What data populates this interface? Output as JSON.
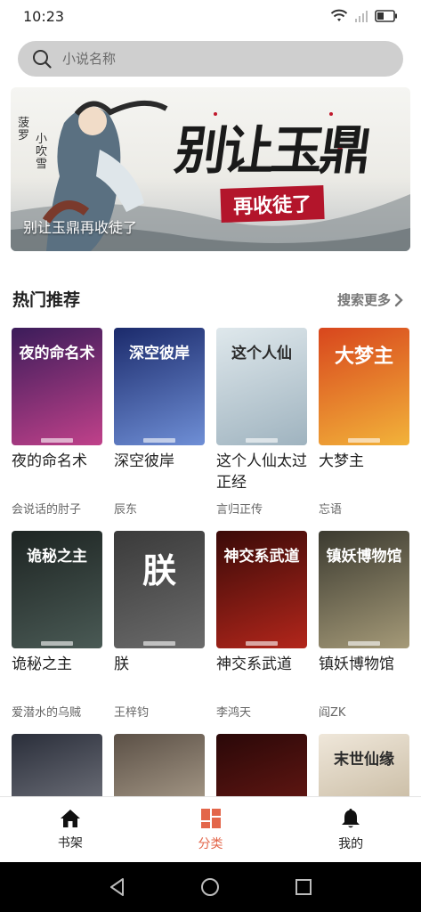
{
  "status_bar": {
    "time": "10:23"
  },
  "search": {
    "placeholder": "小说名称"
  },
  "banner": {
    "caption": "别让玉鼎再收徒了",
    "cover_title": "别让玉鼎",
    "cover_subtitle": "再收徒了",
    "cover_author_a": "菠罗",
    "cover_author_b": "小吹雪"
  },
  "section": {
    "title": "热门推荐",
    "more_label": "搜索更多"
  },
  "books": [
    {
      "title": "夜的命名术",
      "author": "会说话的肘子",
      "cover_text": "夜的命名术",
      "colors": [
        "#3b1c5a",
        "#c0418a"
      ]
    },
    {
      "title": "深空彼岸",
      "author": "辰东",
      "cover_text": "深空彼岸",
      "colors": [
        "#1b2a6b",
        "#6f8fd6"
      ]
    },
    {
      "title": "这个人仙太过正经",
      "author": "言归正传",
      "cover_text": "这个人仙",
      "colors": [
        "#dfe8ec",
        "#9fb3bf"
      ]
    },
    {
      "title": "大梦主",
      "author": "忘语",
      "cover_text": "大梦主",
      "colors": [
        "#d8461d",
        "#f2b33a"
      ]
    },
    {
      "title": "诡秘之主",
      "author": "爱潜水的乌贼",
      "cover_text": "诡秘之主",
      "colors": [
        "#1d2422",
        "#4a5a55"
      ]
    },
    {
      "title": "朕",
      "author": "王梓钧",
      "cover_text": "朕",
      "colors": [
        "#3a3a3a",
        "#6b6b6b"
      ]
    },
    {
      "title": "神交系武道",
      "author": "李鸿天",
      "cover_text": "神交系武道",
      "colors": [
        "#3a0a08",
        "#b3261b"
      ]
    },
    {
      "title": "镇妖博物馆",
      "author": "阎ZK",
      "cover_text": "镇妖博物馆",
      "colors": [
        "#3b3a30",
        "#a59a78"
      ]
    },
    {
      "title": "",
      "author": "",
      "cover_text": "",
      "colors": [
        "#2a2e3a",
        "#8a8c94"
      ]
    },
    {
      "title": "",
      "author": "",
      "cover_text": "",
      "colors": [
        "#5b5046",
        "#c7b9a4"
      ]
    },
    {
      "title": "",
      "author": "",
      "cover_text": "",
      "colors": [
        "#2a0808",
        "#7a1d17"
      ]
    },
    {
      "title": "",
      "author": "",
      "cover_text": "末世仙缘",
      "colors": [
        "#efe7da",
        "#b9a98c"
      ]
    }
  ],
  "tabs": [
    {
      "label": "书架",
      "icon": "home-icon",
      "active": false
    },
    {
      "label": "分类",
      "icon": "category-icon",
      "active": true
    },
    {
      "label": "我的",
      "icon": "bell-icon",
      "active": false
    }
  ],
  "colors": {
    "accent": "#e3664a",
    "search_bg": "#cfcfcf"
  }
}
